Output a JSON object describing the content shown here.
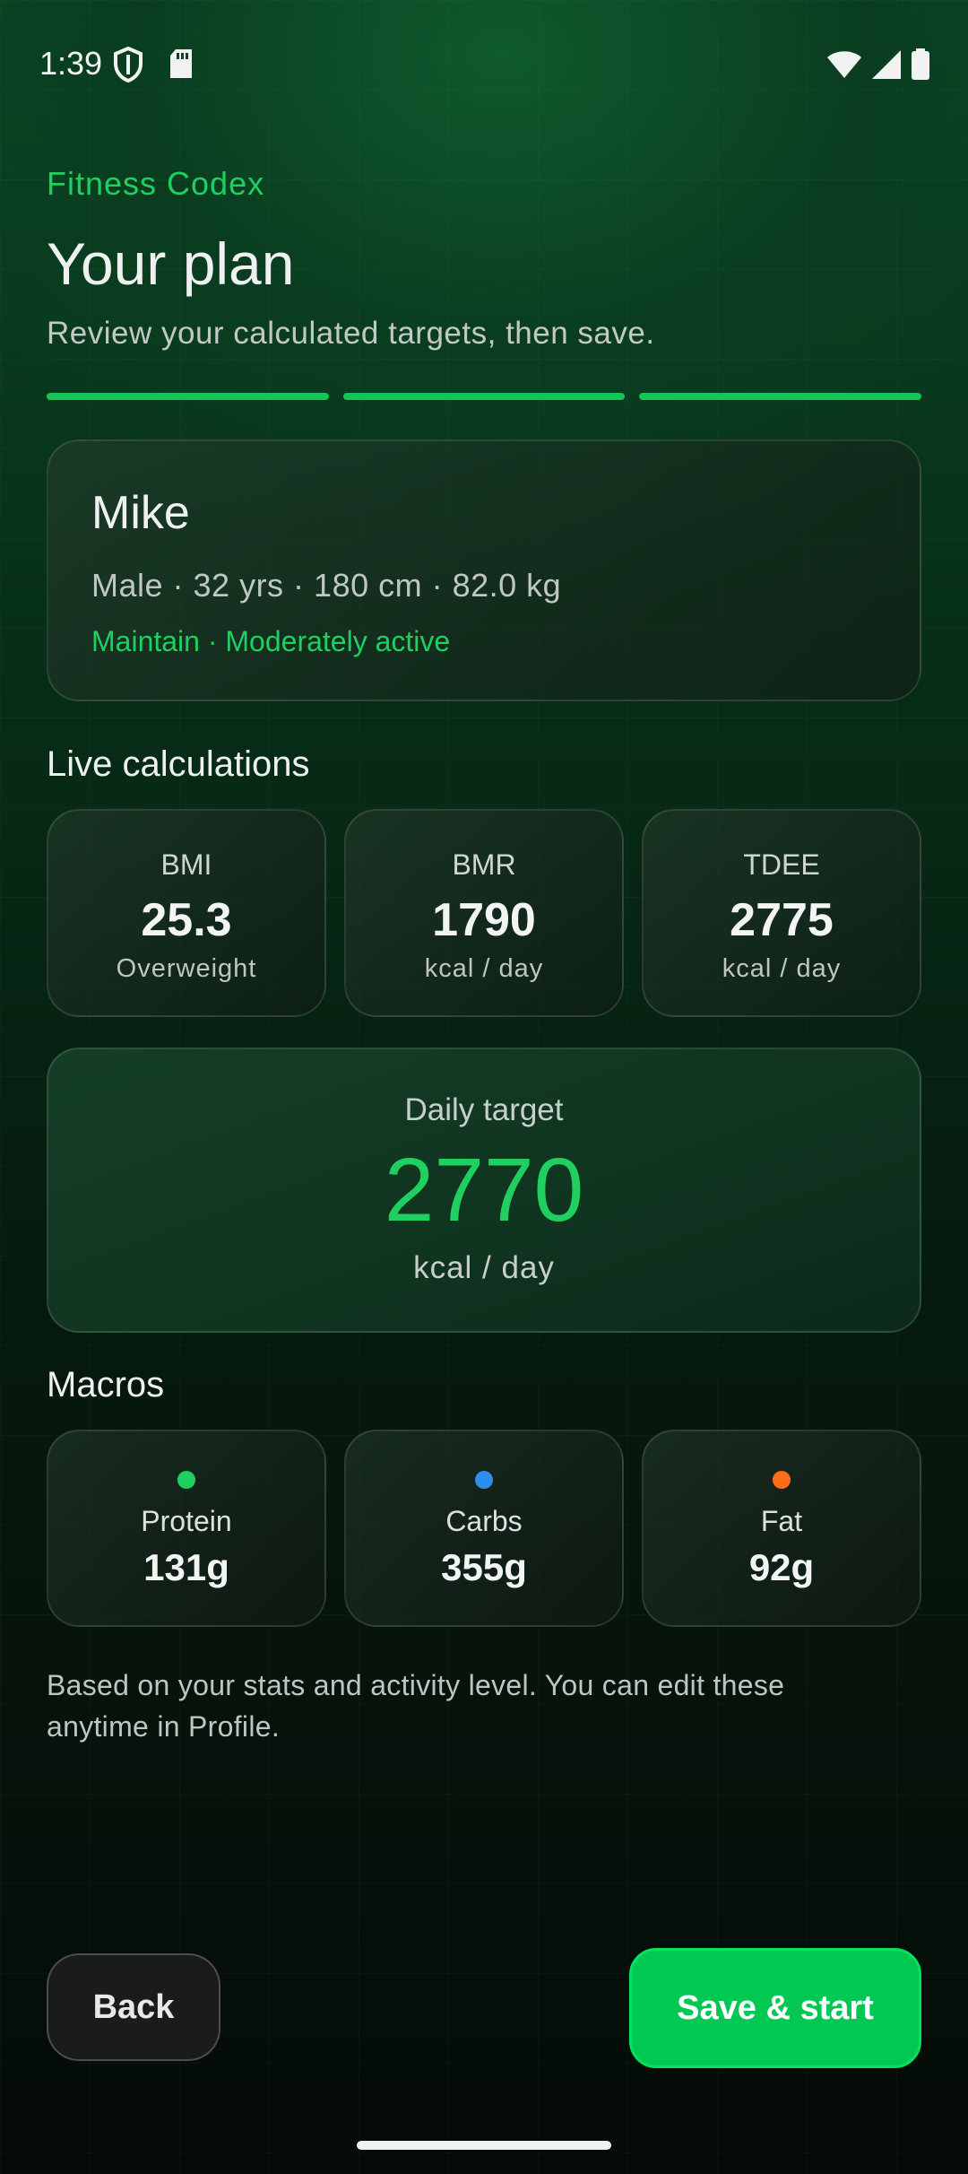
{
  "status_bar": {
    "time": "1:39",
    "icons": [
      "shield-icon",
      "sd-card-icon",
      "wifi-icon",
      "signal-icon",
      "battery-icon"
    ]
  },
  "header": {
    "brand": "Fitness Codex",
    "title": "Your plan",
    "subtitle": "Review your calculated targets, then save.",
    "progress": {
      "steps_total": 3,
      "steps_complete": 3
    }
  },
  "profile": {
    "name": "Mike",
    "stats": "Male · 32 yrs · 180 cm · 82.0 kg",
    "goal": "Maintain · Moderately active"
  },
  "live_calculations": {
    "title": "Live calculations",
    "tiles": [
      {
        "label": "BMI",
        "value": "25.3",
        "sub": "Overweight"
      },
      {
        "label": "BMR",
        "value": "1790",
        "sub": "kcal / day"
      },
      {
        "label": "TDEE",
        "value": "2775",
        "sub": "kcal / day"
      }
    ]
  },
  "daily_target": {
    "label": "Daily target",
    "value": "2770",
    "unit": "kcal / day"
  },
  "macros": {
    "title": "Macros",
    "items": [
      {
        "label": "Protein",
        "value": "131g",
        "color": "#1fcf5f"
      },
      {
        "label": "Carbs",
        "value": "355g",
        "color": "#2f8df0"
      },
      {
        "label": "Fat",
        "value": "92g",
        "color": "#ff6d1a"
      }
    ]
  },
  "footnote": "Based on your stats and activity level. You can edit these anytime in Profile.",
  "actions": {
    "back_label": "Back",
    "save_label": "Save & start"
  },
  "colors": {
    "accent": "#1fcf5f",
    "primary_button": "#00c853"
  }
}
